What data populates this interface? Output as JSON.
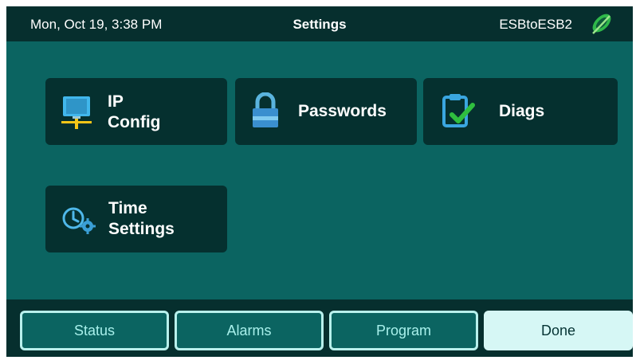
{
  "header": {
    "datetime": "Mon, Oct 19, 3:38 PM",
    "title": "Settings",
    "device": "ESBtoESB2",
    "logo_icon": "leaf-logo-icon"
  },
  "tiles": [
    {
      "line1": "IP",
      "line2": "Config",
      "icon": "network-monitor-icon"
    },
    {
      "line1": "Passwords",
      "icon": "lock-icon"
    },
    {
      "line1": "Diags",
      "icon": "clipboard-check-icon"
    },
    {
      "line1": "Time",
      "line2": "Settings",
      "icon": "clock-gear-icon"
    }
  ],
  "nav": {
    "status": "Status",
    "alarms": "Alarms",
    "program": "Program",
    "done": "Done"
  },
  "colors": {
    "background": "#0b6461",
    "bar": "#062f2e",
    "tile": "#05302f",
    "accent": "#b8f0ec",
    "check": "#2fbf3f"
  }
}
